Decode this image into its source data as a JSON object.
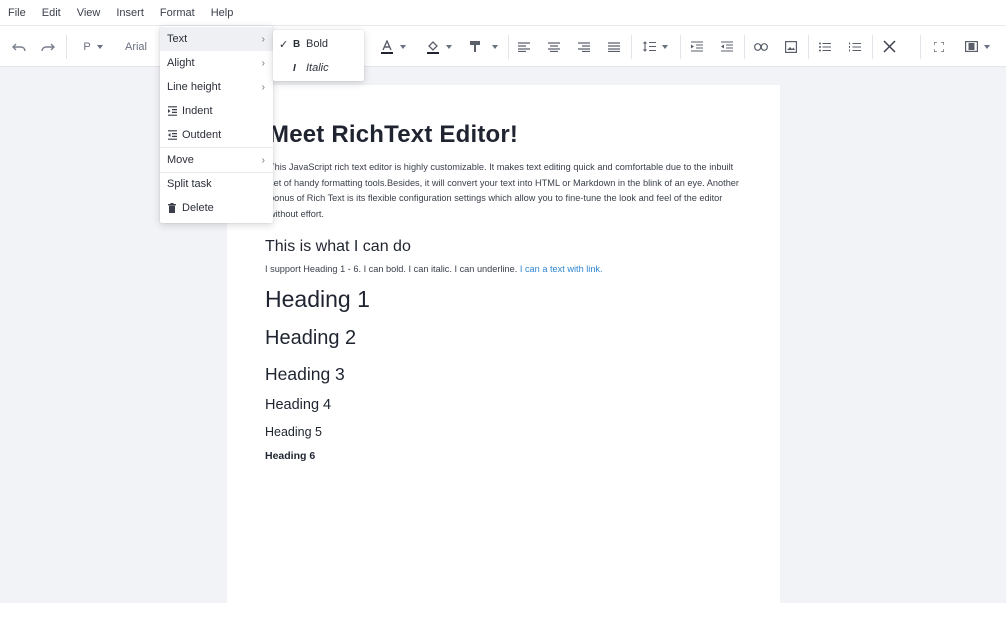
{
  "menubar": {
    "items": [
      "File",
      "Edit",
      "View",
      "Insert",
      "Format",
      "Help"
    ]
  },
  "toolbar": {
    "block_type": "P",
    "font_family": "Arial"
  },
  "format_menu": {
    "items": [
      {
        "label": "Text",
        "has_submenu": true
      },
      {
        "label": "Alight",
        "has_submenu": true
      },
      {
        "label": "Line height",
        "has_submenu": true
      },
      {
        "label": "Indent",
        "icon": "indent-icon"
      },
      {
        "label": "Outdent",
        "icon": "outdent-icon"
      },
      {
        "label": "Move",
        "has_submenu": true
      },
      {
        "label": "Split task"
      },
      {
        "label": "Delete",
        "icon": "trash-icon"
      }
    ]
  },
  "text_submenu": {
    "items": [
      {
        "label": "Bold",
        "glyph": "B",
        "checked": true
      },
      {
        "label": "Italic",
        "glyph": "I",
        "checked": false
      }
    ]
  },
  "document": {
    "title": "Meet RichText Editor!",
    "paragraph": "This JavaScript rich text editor is highly customizable. It makes text editing quick and comfortable due to the inbuilt set of handy formatting tools.Besides, it will convert your text into HTML or Markdown in the blink of an eye. Another bonus of Rich Text is its flexible configuration settings which allow you to fine-tune the look and feel of the editor without effort.",
    "subheading": "This is what I can do",
    "capabilities": "I support Heading 1 - 6. I can bold. I can italic. I can underline. ",
    "link_text": "I can a text with link.",
    "headings": [
      "Heading 1",
      "Heading 2",
      "Heading 3",
      "Heading 4",
      "Heading 5",
      "Heading 6"
    ]
  }
}
